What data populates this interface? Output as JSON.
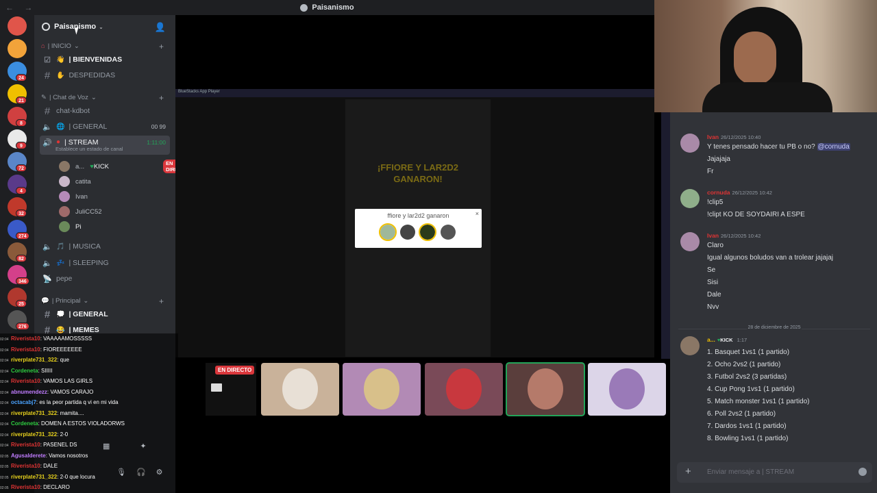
{
  "window": {
    "title": "Paisanismo",
    "nav": "← →"
  },
  "server": {
    "name": "Paisanismo"
  },
  "server_badges": [
    "24",
    "21",
    "8",
    "9",
    "72",
    "4",
    "32",
    "274",
    "82",
    "346",
    "25",
    "276"
  ],
  "categories": {
    "inicio": "| INICIO",
    "voz": "| Chat de Voz",
    "principal": "| Principal"
  },
  "channels": {
    "bienvenidas": "| BIENVENIDAS",
    "despedidas": "DESPEDIDAS",
    "chat_kdbot": "chat-kdbot",
    "general_voice": "| GENERAL",
    "general_voice_count": "00  99",
    "stream": "| STREAM",
    "stream_time": "1:11:00",
    "stream_status": "Establece un estado de canal",
    "musica": "| MUSICA",
    "sleeping": "| SLEEPING",
    "pepe": "pepe",
    "general_text": "| GENERAL",
    "memes": "| MEMES"
  },
  "voice_users": [
    {
      "name": "a...",
      "tag": "KICK",
      "live": "EN DIRECTO"
    },
    {
      "name": "catita"
    },
    {
      "name": "Ivan"
    },
    {
      "name": "JuliCC52"
    },
    {
      "name": "Pi"
    }
  ],
  "stream": {
    "app_title": "BlueStacks App Player",
    "win_text": "¡FFIORE Y LAR2D2 GANARON!",
    "popup_text": "ffiore y lar2d2 ganaron",
    "popup_close": "×",
    "live_tag": "EN DIRECTO"
  },
  "chat": {
    "messages": [
      {
        "user": "Ivan",
        "user_color": "#e03434",
        "time": "26/12/2025 10:40",
        "lines": [
          "Y tenes pensado hacer tu PB o no?",
          "Jajajaja",
          "Fr"
        ],
        "mention": "@cornuda"
      },
      {
        "user": "cornuda",
        "user_color": "#e03434",
        "time": "26/12/2025 10:42",
        "lines": [
          "!clip5",
          "!clipt KO DE SOYDAIRI A ESPE"
        ]
      },
      {
        "user": "Ivan",
        "user_color": "#e03434",
        "time": "26/12/2025 10:42",
        "lines": [
          "Claro",
          "Igual algunos boludos van a trolear jajajaj",
          "Se",
          "Sisi",
          "Dale",
          "Nvv"
        ]
      },
      {
        "user": "a...",
        "tag": "KICK",
        "time": "1:17",
        "lines": [
          "1. Basquet 1vs1 (1 partido)",
          "2. Ocho 2vs2 (1 partido)",
          "3. Futbol 2vs2 (3 partidas)",
          "4. Cup Pong 1vs1 (1 partido)",
          "5. Match monster 1vs1 (1 partido)",
          "6. Poll 2vs2 (1 partido)",
          "7. Dardos 1vs1 (1 partido)",
          "8. Bowling 1vs1 (1 partido)"
        ]
      }
    ],
    "date_divider": "28 de diciembre de 2025",
    "composer_placeholder": "Enviar mensaje a | STREAM"
  },
  "overlay_chat": [
    {
      "time": "02:04",
      "user": "Riverista10",
      "color": "#e03434",
      "text": ": VAAAAAMOSSSSS"
    },
    {
      "time": "02:04",
      "user": "Riverista10",
      "color": "#e03434",
      "text": ": FIOREEEEEEE"
    },
    {
      "time": "02:04",
      "user": "riverplate731_322",
      "color": "#e8d21d",
      "text": ": que"
    },
    {
      "time": "02:04",
      "user": "Cordeneta",
      "color": "#2ecc40",
      "text": ": SIIIII"
    },
    {
      "time": "02:04",
      "user": "Riverista10",
      "color": "#e03434",
      "text": ": VAMOS LAS GIRLS"
    },
    {
      "time": "02:04",
      "user": "abnumendezz",
      "color": "#c17dff",
      "text": ": VAMOS CARAJO"
    },
    {
      "time": "02:04",
      "user": "octacabj7",
      "color": "#4aa3ff",
      "text": ": es la peor partida q vi en mi vida"
    },
    {
      "time": "02:04",
      "user": "riverplate731_322",
      "color": "#e8d21d",
      "text": ": mamita...."
    },
    {
      "time": "02:04",
      "user": "Cordeneta",
      "color": "#2ecc40",
      "text": ": DOMEN A ESTOS VIOLADORWS"
    },
    {
      "time": "02:04",
      "user": "riverplate731_322",
      "color": "#e8d21d",
      "text": ": 2-0"
    },
    {
      "time": "02:04",
      "user": "Riverista10",
      "color": "#e03434",
      "text": ": PASENEL DS"
    },
    {
      "time": "02:05",
      "user": "Agusalderete",
      "color": "#c17dff",
      "text": ": Vamos nosotros"
    },
    {
      "time": "02:05",
      "user": "Riverista10",
      "color": "#e03434",
      "text": ": DALE"
    },
    {
      "time": "02:05",
      "user": "riverplate731_322",
      "color": "#e8d21d",
      "text": ": 2-0 que locura"
    },
    {
      "time": "02:05",
      "user": "Riverista10",
      "color": "#e03434",
      "text": ": DECLARO"
    }
  ],
  "colors": {
    "accent_red": "#da373c",
    "green": "#23a559",
    "blurple": "#5865f2"
  }
}
